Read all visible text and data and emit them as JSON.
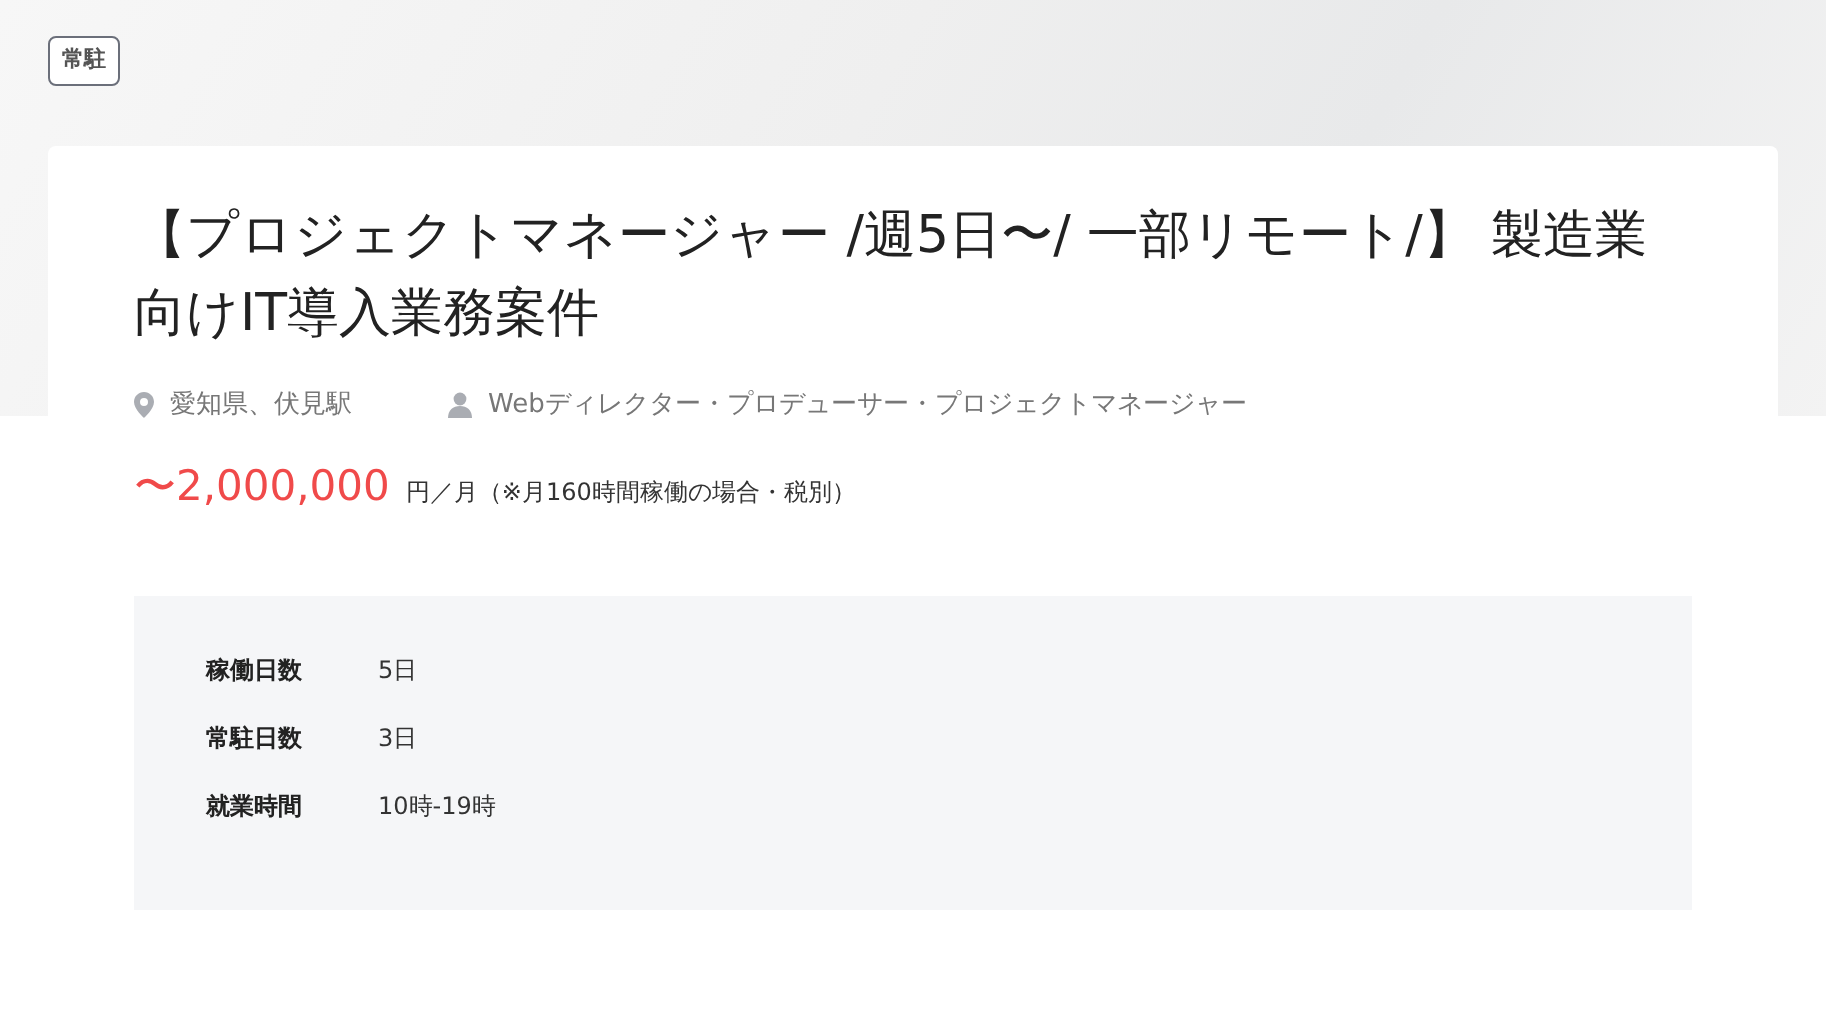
{
  "tag": "常駐",
  "title": "【プロジェクトマネージャー /週5日〜/ 一部リモート/】 製造業向けIT導入業務案件",
  "location": "愛知県、伏見駅",
  "role": "Webディレクター・プロデューサー・プロジェクトマネージャー",
  "price": {
    "amount": "〜2,000,000",
    "unit": "円／月（※月160時間稼働の場合・税別）"
  },
  "details": [
    {
      "label": "稼働日数",
      "value": "5日"
    },
    {
      "label": "常駐日数",
      "value": "3日"
    },
    {
      "label": "就業時間",
      "value": "10時-19時"
    }
  ]
}
